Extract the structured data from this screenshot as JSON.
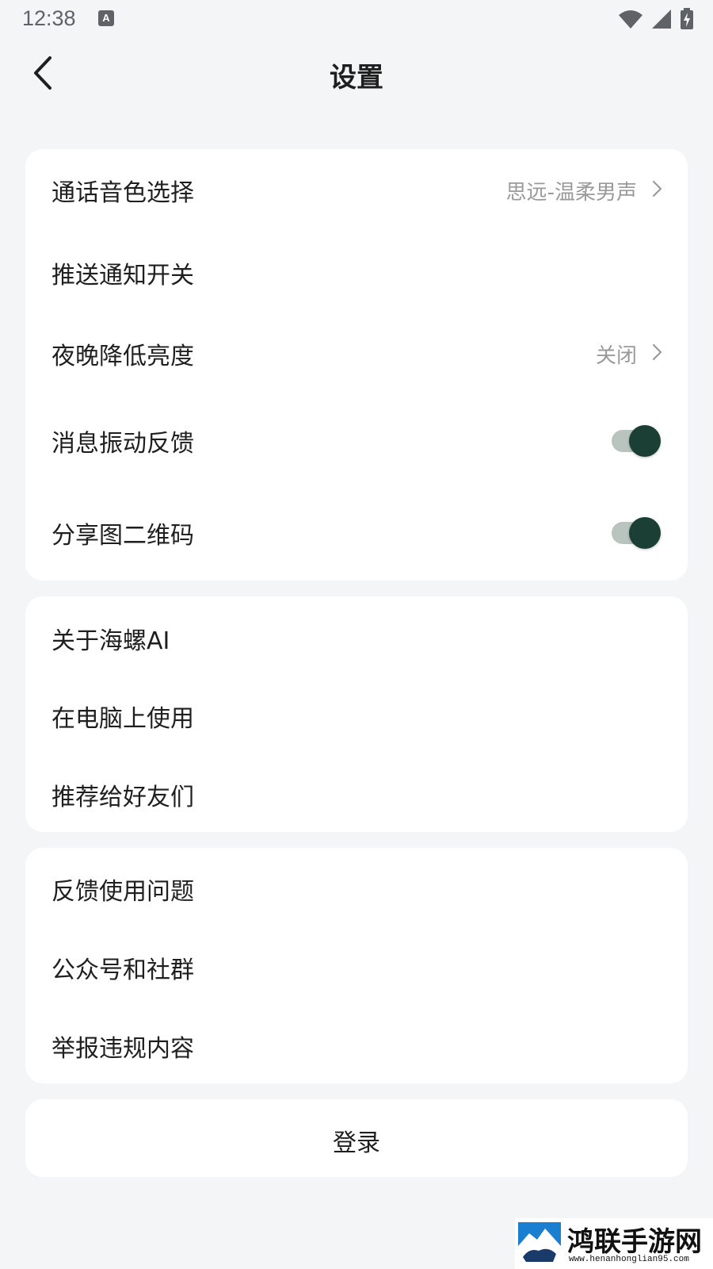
{
  "status_bar": {
    "time": "12:38",
    "icons": [
      "text-a-icon",
      "wifi-icon",
      "signal-icon",
      "battery-charging-icon"
    ]
  },
  "header": {
    "title": "设置",
    "back_icon": "chevron-left-icon"
  },
  "section_1": {
    "items": [
      {
        "label": "通话音色选择",
        "value": "思远-温柔男声",
        "type": "link"
      },
      {
        "label": "推送通知开关",
        "type": "plain"
      },
      {
        "label": "夜晚降低亮度",
        "value": "关闭",
        "type": "link"
      },
      {
        "label": "消息振动反馈",
        "type": "toggle",
        "on": true
      },
      {
        "label": "分享图二维码",
        "type": "toggle",
        "on": true
      }
    ]
  },
  "section_2": {
    "items": [
      {
        "label": "关于海螺AI"
      },
      {
        "label": "在电脑上使用"
      },
      {
        "label": "推荐给好友们"
      }
    ]
  },
  "section_3": {
    "items": [
      {
        "label": "反馈使用问题"
      },
      {
        "label": "公众号和社群"
      },
      {
        "label": "举报违规内容"
      }
    ]
  },
  "login": {
    "label": "登录"
  },
  "watermark": {
    "brand": "鸿联手游网",
    "url": "www.henanhonglian95.com"
  },
  "colors": {
    "background": "#f4f5f7",
    "card": "#ffffff",
    "toggle_knob": "#1c3f35",
    "toggle_track": "#b9c4bf",
    "secondary_text": "#9a9a9a"
  }
}
